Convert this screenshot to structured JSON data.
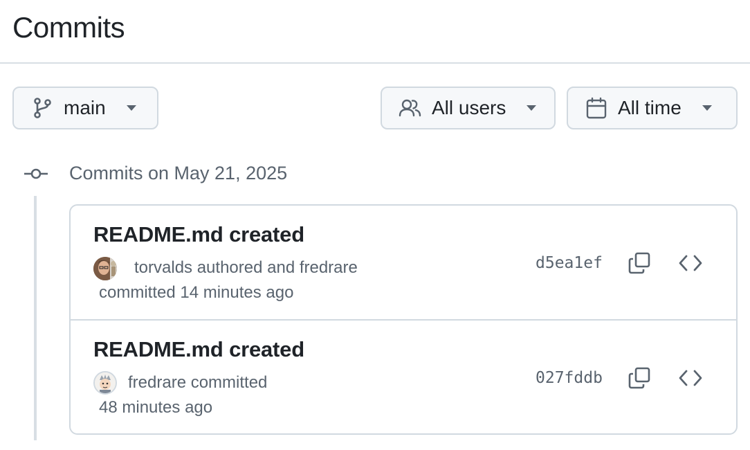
{
  "header": {
    "title": "Commits"
  },
  "filters": {
    "branch": {
      "label": "main",
      "icon": "git-branch-icon"
    },
    "users": {
      "label": "All users",
      "icon": "people-icon"
    },
    "time": {
      "label": "All time",
      "icon": "calendar-icon"
    }
  },
  "group": {
    "heading": "Commits on May 21, 2025"
  },
  "commits": [
    {
      "title": "README.md created",
      "meta_line1": "torvalds authored and fredrare",
      "meta_line2": "committed 14 minutes ago",
      "sha": "d5ea1ef"
    },
    {
      "title": "README.md created",
      "meta_line1": "fredrare committed",
      "meta_line2": "48 minutes ago",
      "sha": "027fddb"
    }
  ],
  "colors": {
    "border": "#d1d9e0",
    "muted": "#59636e",
    "text": "#1f2328",
    "button_bg": "#f6f8fa"
  }
}
